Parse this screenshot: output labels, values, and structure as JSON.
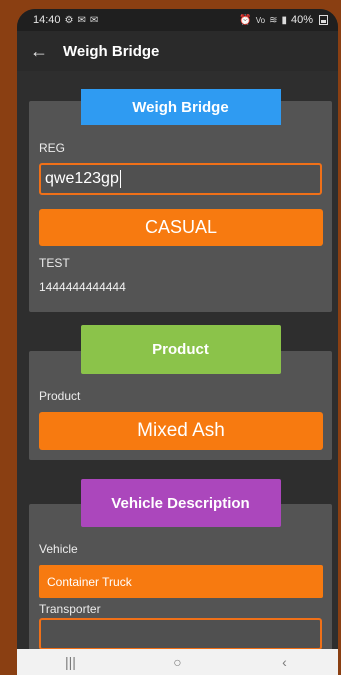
{
  "status_bar": {
    "time": "14:40",
    "battery": "40%",
    "left_icons": [
      "settings-icon",
      "mail-icon",
      "mail-icon"
    ],
    "right_icons": [
      "alarm-icon",
      "vowifi-icon",
      "wifi-icon",
      "signal-icon"
    ]
  },
  "app_bar": {
    "title": "Weigh Bridge",
    "back_icon": "arrow-left-icon"
  },
  "weigh_bridge": {
    "header": "Weigh Bridge",
    "reg_label": "REG",
    "reg_value": "qwe123gp",
    "type_button": "CASUAL",
    "test_label": "TEST",
    "test_value": "1444444444444"
  },
  "product": {
    "header": "Product",
    "label": "Product",
    "value": "Mixed Ash"
  },
  "vehicle_description": {
    "header": "Vehicle Description",
    "vehicle_label": "Vehicle",
    "vehicle_value": "Container Truck",
    "transporter_label": "Transporter",
    "transporter_value": ""
  },
  "nav_bar": {
    "recents": "|||",
    "home": "○",
    "back": "‹"
  },
  "colors": {
    "blue_header": "#2f9bf2",
    "green_header": "#8bc34a",
    "purple_header": "#ab47bc",
    "orange": "#f77a10",
    "panel": "#545454"
  }
}
